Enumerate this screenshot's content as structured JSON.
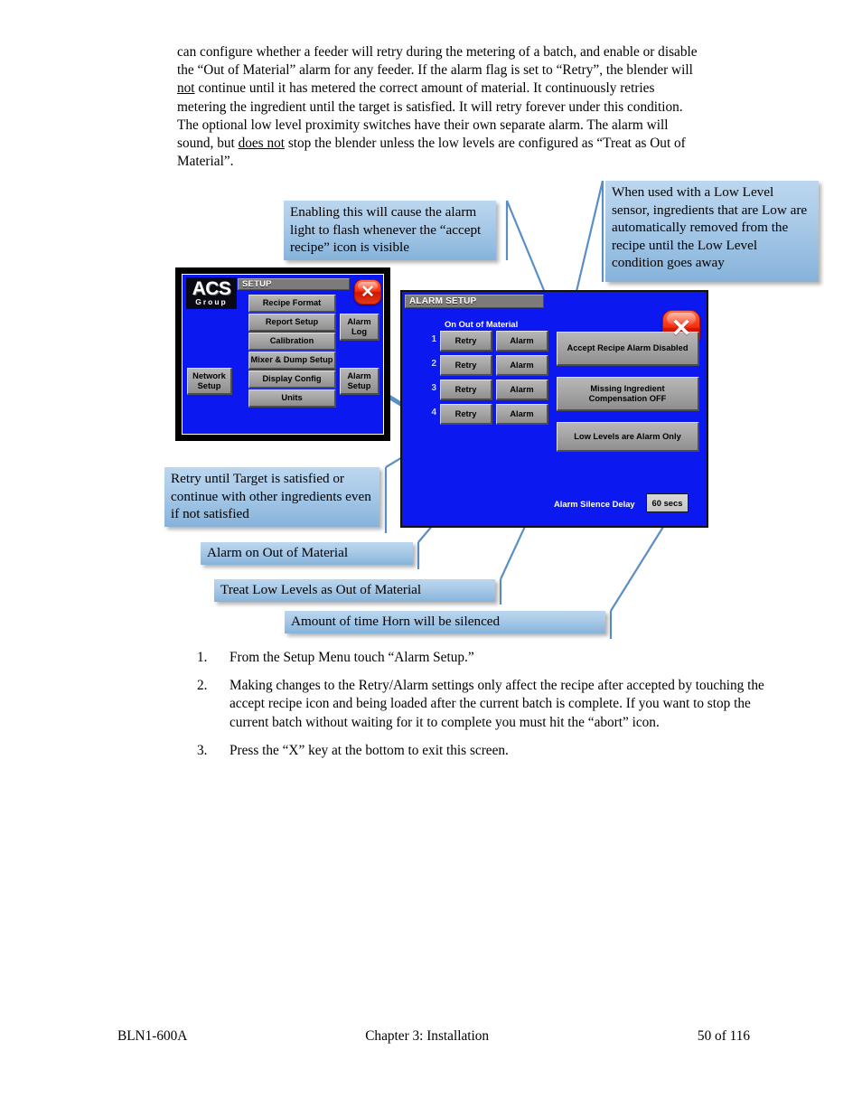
{
  "body_text": {
    "lines": [
      "can configure whether a feeder will retry during the metering of a batch, and enable or disable",
      "the “Out of Material” alarm for any feeder. If the alarm flag is set to “Retry”, the blender will",
      "not continue until it has metered the correct amount of material.  It continuously retries",
      "metering the ingredient until the target is satisfied.  It will retry forever under this condition.",
      "The optional low level proximity switches have their own separate alarm.  The alarm will",
      "sound, but does not stop the blender unless the low levels are configured as “Treat as Out of",
      "Material”."
    ],
    "line1": "can configure whether a feeder will retry during the metering of a batch, and enable or disable",
    "line2": "the “Out of Material” alarm for any feeder. If the alarm flag is set to “Retry”, the blender will",
    "line3_underlined": "not",
    "line3_rest": " continue until it has metered the correct amount of material.  It continuously retries",
    "line4": "metering the ingredient until the target is satisfied.  It will retry forever under this condition.",
    "line5": "The optional low level proximity switches have their own separate alarm.  The alarm will",
    "line6_pre": "sound, but ",
    "line6_underlined": "does not",
    "line6_rest": " stop the blender unless the low levels are configured as “Treat as Out of",
    "line7": "Material”."
  },
  "callouts": {
    "accept_recipe": "Enabling this will cause the alarm light to flash whenever the “accept recipe” icon is visible",
    "low_level": "When used with a Low Level sensor, ingredients that are Low are automatically removed from the recipe until the Low Level condition goes away",
    "retry": "Retry until Target is satisfied or continue with other ingredients even if not satisfied",
    "alarm_on_oom": "Alarm on Out of Material",
    "treat_low_levels": "Treat Low Levels as Out of Material",
    "horn_time": "Amount of time Horn will be silenced"
  },
  "setup_screen": {
    "title": "SETUP",
    "logo_top": "ACS",
    "logo_bottom": "Group",
    "close_label": "✕",
    "center_buttons": [
      "Recipe Format",
      "Report Setup",
      "Calibration",
      "Mixer & Dump Setup",
      "Display Config",
      "Units"
    ],
    "right_buttons": [
      {
        "line1": "Alarm",
        "line2": "Log"
      },
      {
        "line1": "Alarm",
        "line2": "Setup"
      }
    ],
    "left_button": {
      "line1": "Network",
      "line2": "Setup"
    }
  },
  "alarm_screen": {
    "title": "ALARM SETUP",
    "close_label": "✕",
    "column_header": "On Out of Material",
    "rows": [
      {
        "num": "1",
        "retry": "Retry",
        "alarm": "Alarm"
      },
      {
        "num": "2",
        "retry": "Retry",
        "alarm": "Alarm"
      },
      {
        "num": "3",
        "retry": "Retry",
        "alarm": "Alarm"
      },
      {
        "num": "4",
        "retry": "Retry",
        "alarm": "Alarm"
      }
    ],
    "toggle_buttons": [
      {
        "line1": "Accept Recipe Alarm Disabled",
        "line2": ""
      },
      {
        "line1": "Missing Ingredient",
        "line2": "Compensation OFF"
      },
      {
        "line1": "Low Levels are Alarm Only",
        "line2": ""
      }
    ],
    "silence_delay_label": "Alarm Silence Delay",
    "silence_delay_value": "60 secs"
  },
  "steps": [
    {
      "num": "1.",
      "text": "From the Setup Menu touch “Alarm Setup.”"
    },
    {
      "num": "2.",
      "text": "Making changes to the Retry/Alarm settings only affect the recipe after accepted by touching the accept recipe icon and being loaded after the current batch is complete. If you want to stop the current batch without waiting for it to complete you must hit the “abort” icon."
    },
    {
      "num": "3.",
      "text": "Press the “X” key at the bottom to exit this screen."
    }
  ],
  "footer": {
    "left": "BLN1-600A",
    "middle": "Chapter 3: Installation",
    "right": "50 of 116"
  },
  "colors": {
    "hmi_blue": "#0b18ef",
    "callout_light": "#bcd7ef",
    "callout_dark": "#86b3da",
    "connector": "#5b8ec4",
    "close_red": "#e8300f",
    "button_grey": "#a6a6a6"
  }
}
